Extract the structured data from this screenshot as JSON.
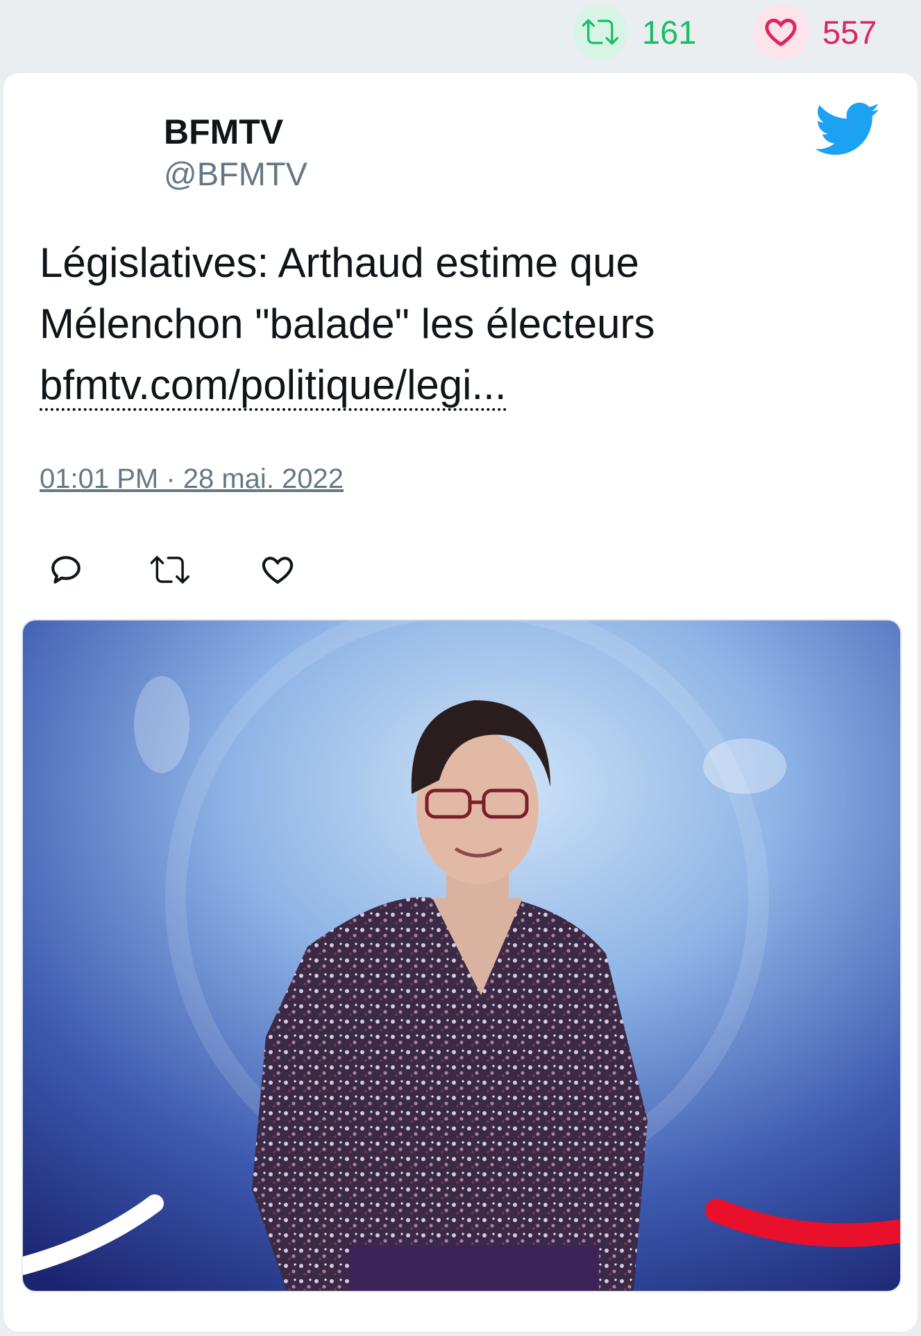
{
  "stats": {
    "retweet_icon": "retweet-icon",
    "retweet_count": "161",
    "like_icon": "heart-icon",
    "like_count": "557"
  },
  "tweet": {
    "author": {
      "display_name": "BFMTV",
      "handle": "@BFMTV"
    },
    "brand_icon": "twitter-bird-icon",
    "text_lines": [
      "Législatives: Arthaud estime que",
      "Mélenchon \"balade\" les électeurs"
    ],
    "link_text": "bfmtv.com/politique/legi...",
    "timestamp": "01:01 PM · 28 mai. 2022",
    "actions": {
      "reply_icon": "reply-icon",
      "retweet_icon": "retweet-icon",
      "like_icon": "heart-icon"
    },
    "media_description": "photo-icon"
  },
  "colors": {
    "background": "#eaeef1",
    "card": "#ffffff",
    "retweet_green": "#17bf63",
    "like_red": "#e0245e",
    "twitter_blue": "#1da1f2",
    "muted_gray": "#657786",
    "text": "#0f1419"
  }
}
